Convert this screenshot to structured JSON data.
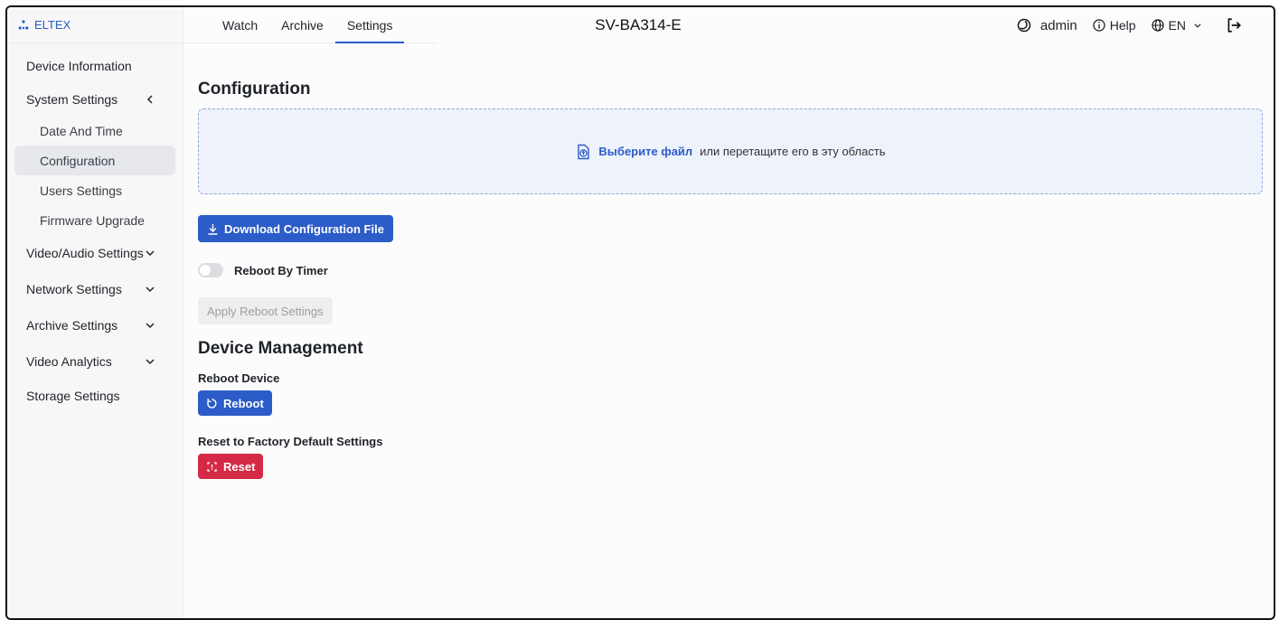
{
  "brand": {
    "name": "ELTEX"
  },
  "header": {
    "tabs": [
      {
        "label": "Watch"
      },
      {
        "label": "Archive"
      },
      {
        "label": "Settings"
      }
    ],
    "device_title": "SV-BA314-E",
    "user": "admin",
    "help": "Help",
    "language": "EN"
  },
  "sidebar": {
    "items": [
      {
        "label": "Device Information"
      },
      {
        "label": "System Settings"
      },
      {
        "label": "Date And Time"
      },
      {
        "label": "Configuration"
      },
      {
        "label": "Users Settings"
      },
      {
        "label": "Firmware Upgrade"
      },
      {
        "label": "Video/Audio Settings"
      },
      {
        "label": "Network Settings"
      },
      {
        "label": "Archive Settings"
      },
      {
        "label": "Video Analytics"
      },
      {
        "label": "Storage Settings"
      }
    ]
  },
  "main": {
    "config_title": "Configuration",
    "dropzone": {
      "link": "Выберите файл",
      "text": "или перетащите его в эту область"
    },
    "download_button": "Download Configuration File",
    "reboot_timer_label": "Reboot By Timer",
    "apply_reboot_button": "Apply Reboot Settings",
    "device_management_title": "Device Management",
    "reboot_device_label": "Reboot Device",
    "reboot_button": "Reboot",
    "factory_reset_label": "Reset to Factory Default Settings",
    "reset_button": "Reset"
  },
  "colors": {
    "accent": "#2b5cc8",
    "danger": "#d42a45",
    "active_nav": "#e6e8ee"
  }
}
